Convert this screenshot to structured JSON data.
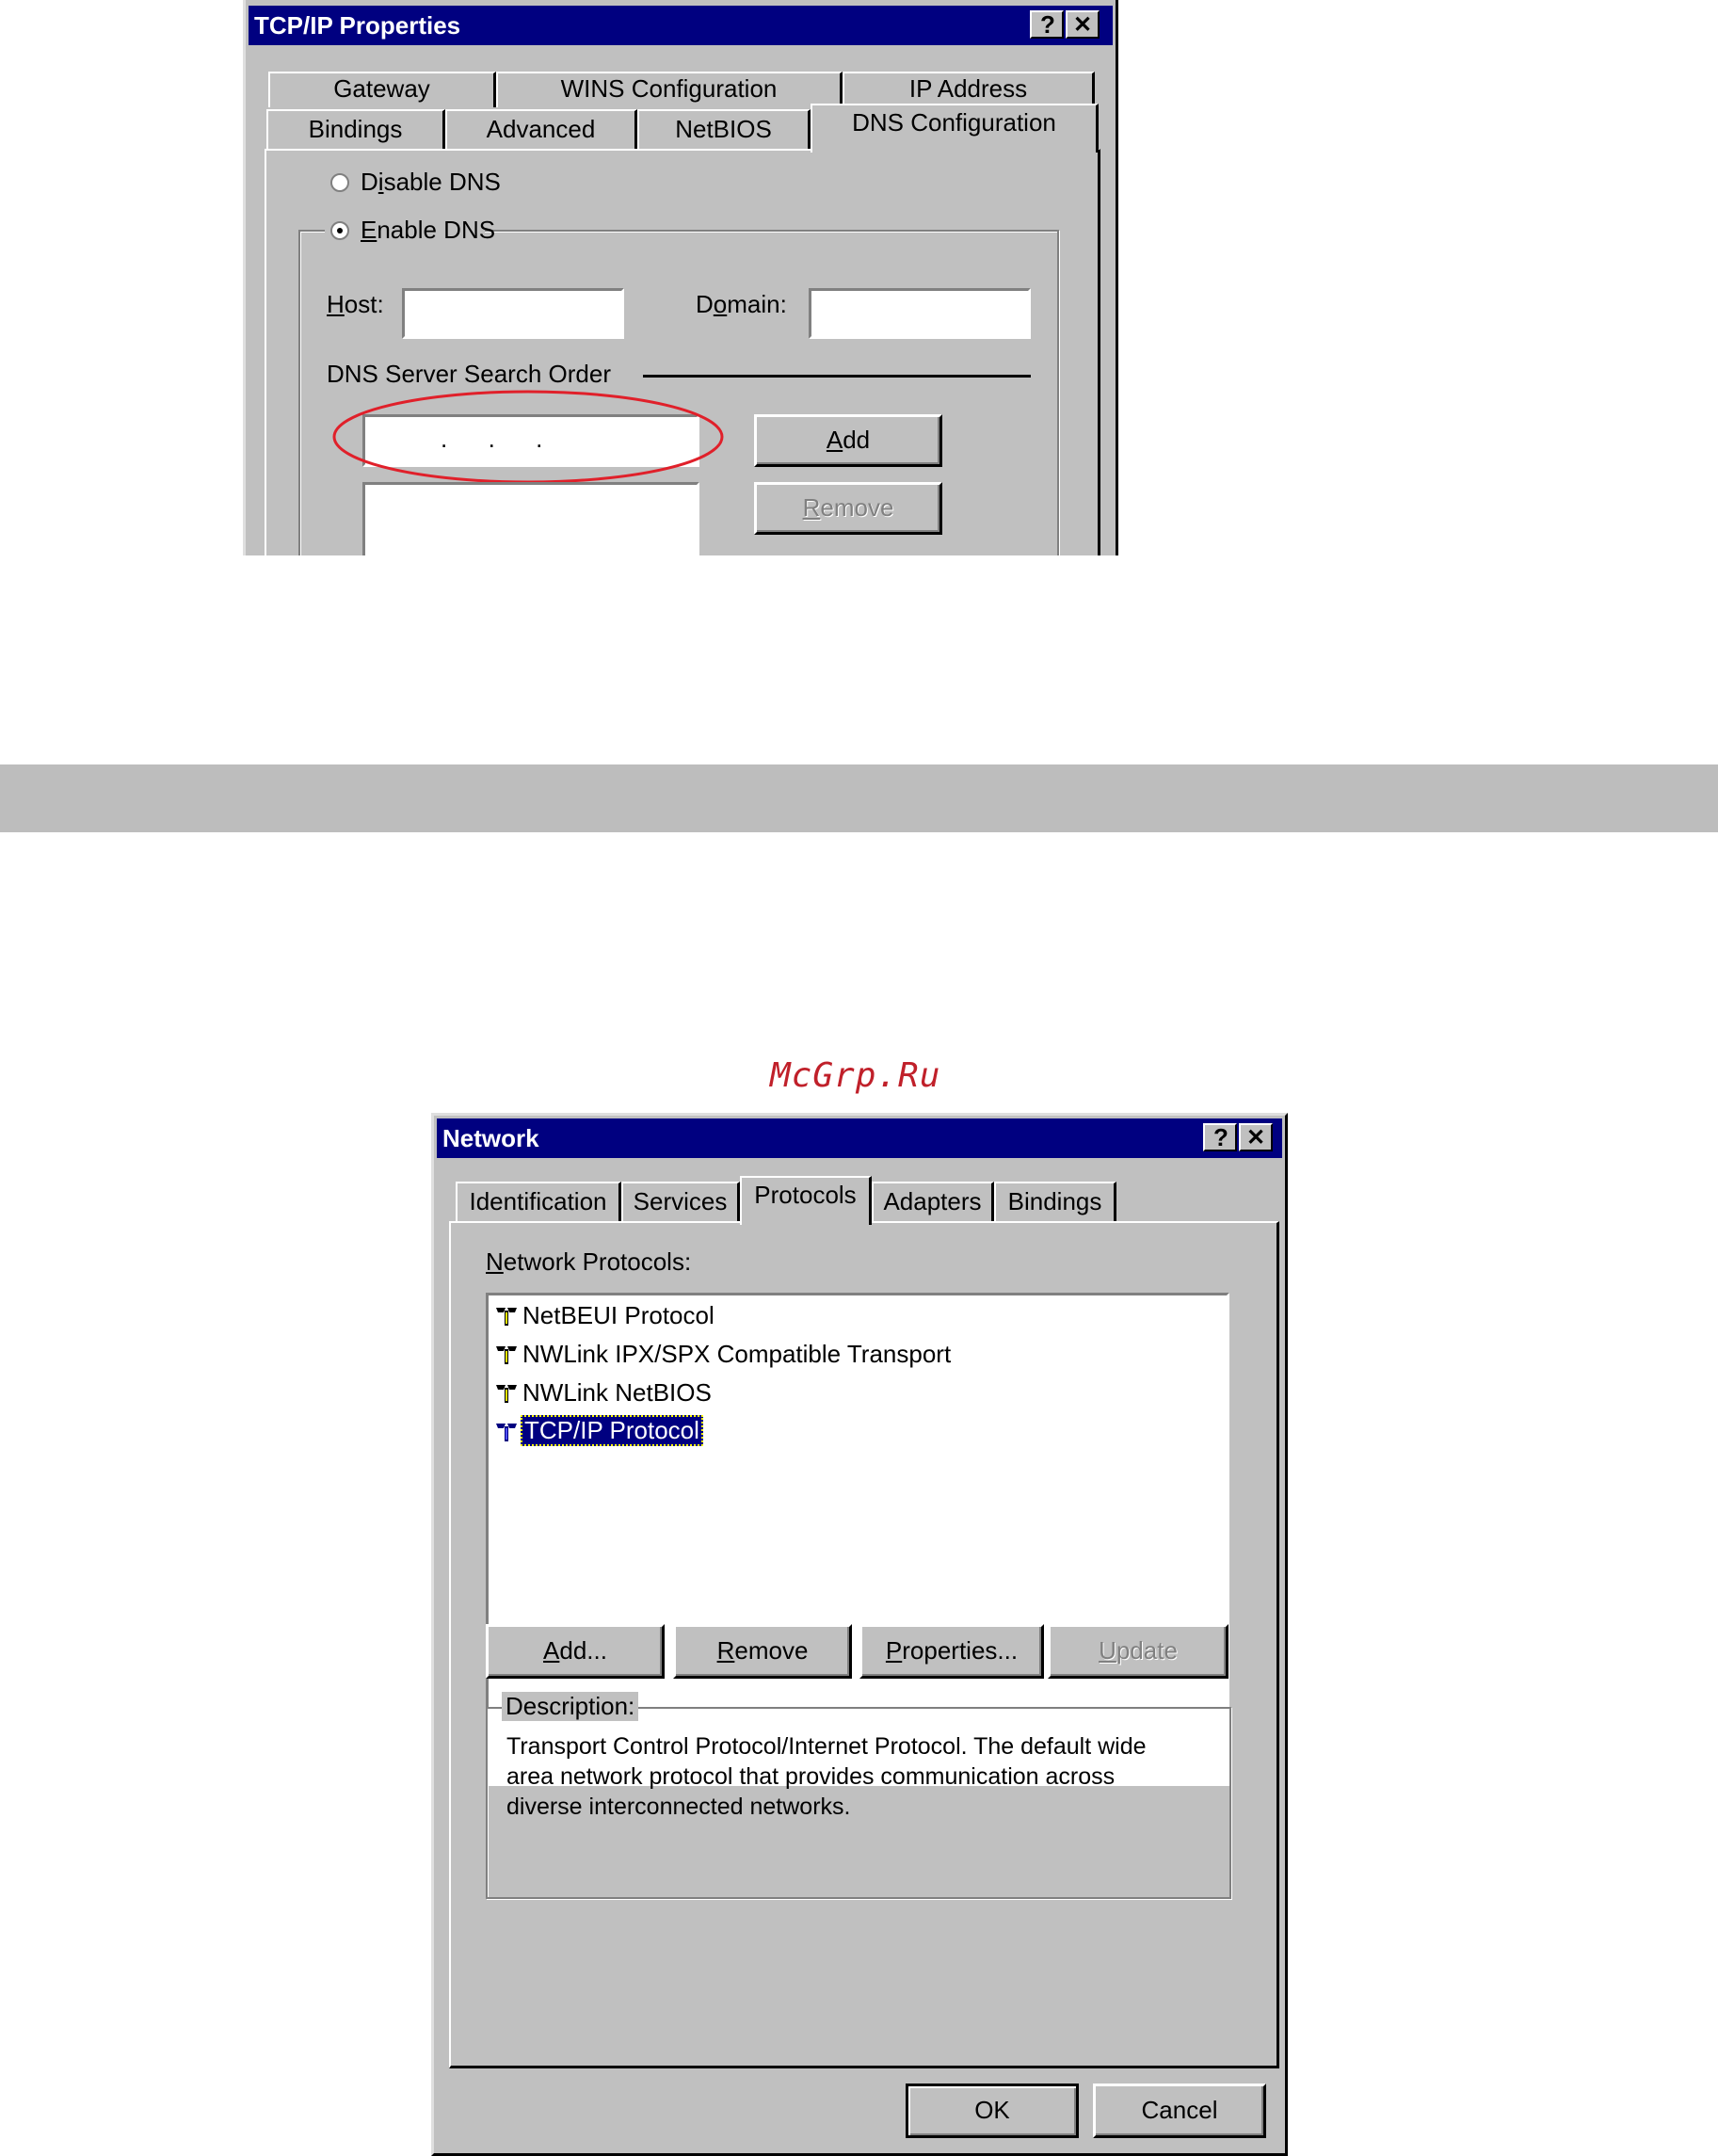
{
  "tcpip": {
    "title": "TCP/IP Properties",
    "help": "?",
    "close": "✕",
    "tabs_row1": [
      "Gateway",
      "WINS Configuration",
      "IP Address"
    ],
    "tabs_row2": [
      "Bindings",
      "Advanced",
      "NetBIOS"
    ],
    "active_tab": "DNS Configuration",
    "disable_dns": {
      "pre": "D",
      "ul": "i",
      "post": "sable DNS"
    },
    "enable_dns": {
      "pre": "",
      "ul": "E",
      "post": "nable DNS"
    },
    "host": {
      "ul": "H",
      "post": "ost:"
    },
    "domain": {
      "pre": "D",
      "ul": "o",
      "post": "main:"
    },
    "dns_order_label": "DNS Server Search Order",
    "ip_dots": ".      .      .",
    "add": {
      "ul": "A",
      "post": "dd"
    },
    "remove": {
      "ul": "R",
      "post": "emove"
    }
  },
  "watermark": "McGrp.Ru",
  "network": {
    "title": "Network",
    "help": "?",
    "close": "✕",
    "tabs": [
      "Identification",
      "Services",
      "Adapters",
      "Bindings"
    ],
    "active_tab": "Protocols",
    "protocols_label": {
      "ul": "N",
      "post": "etwork Protocols:"
    },
    "protocols": [
      "NetBEUI Protocol",
      "NWLink IPX/SPX Compatible Transport",
      "NWLink NetBIOS",
      "TCP/IP Protocol"
    ],
    "selected_protocol": "TCP/IP Protocol",
    "buttons": {
      "add": {
        "ul": "A",
        "post": "dd..."
      },
      "remove": {
        "ul": "R",
        "post": "emove"
      },
      "properties": {
        "ul": "P",
        "post": "roperties..."
      },
      "update": {
        "ul": "U",
        "post": "pdate"
      }
    },
    "description_label": "Description:",
    "description_lines": [
      "Transport Control Protocol/Internet Protocol. The default wide",
      "area network protocol that provides communication across",
      "diverse interconnected networks."
    ],
    "ok": "OK",
    "cancel": "Cancel"
  },
  "colors": {
    "title_bar": "#000080",
    "window_face": "#c0c0c0",
    "band": "#bdbdbd",
    "highlight_ellipse": "#e0202a",
    "watermark": "#c0202a"
  }
}
